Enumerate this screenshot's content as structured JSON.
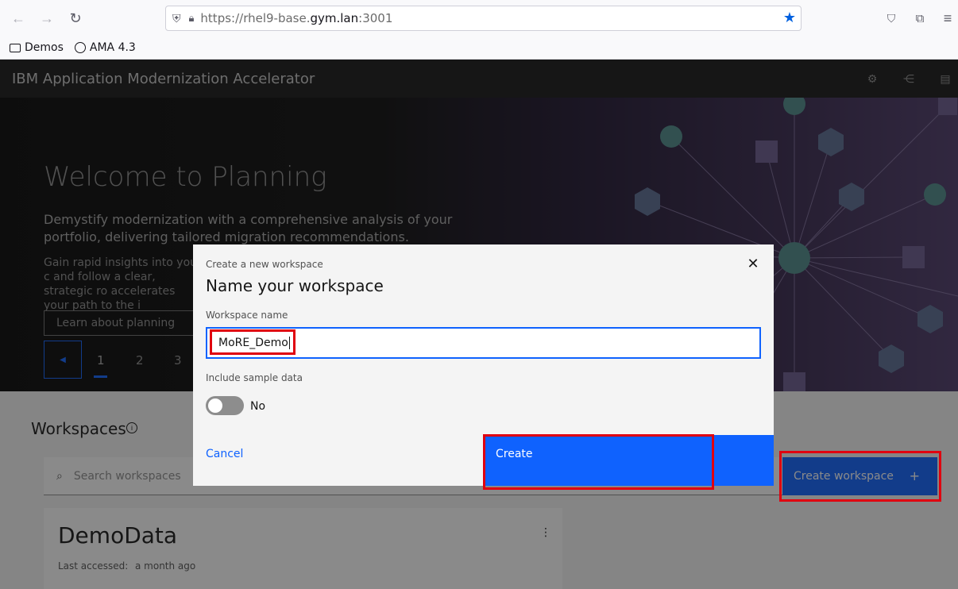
{
  "browser": {
    "url_prefix": "https://rhel9-base.",
    "url_domain": "gym.lan",
    "url_suffix": ":3001",
    "bookmarks": [
      {
        "label": "Demos",
        "icon": "folder-icon"
      },
      {
        "label": "AMA 4.3",
        "icon": "globe-icon"
      }
    ]
  },
  "header": {
    "title": "IBM Application Modernization Accelerator",
    "icons": [
      "settings-icon",
      "topology-icon",
      "document-icon"
    ]
  },
  "hero": {
    "title": "Welcome to Planning",
    "subtitle": "Demystify modernization with a comprehensive analysis of your portfolio, delivering tailored migration recommendations.",
    "body": "Gain rapid insights into your c and follow a clear, strategic ro accelerates your path to the i",
    "learn_button": "Learn about planning",
    "pages": [
      "1",
      "2",
      "3"
    ],
    "active_page": "1"
  },
  "workspaces": {
    "title": "Workspaces",
    "search_placeholder": "Search workspaces",
    "create_button": "Create workspace",
    "cards": [
      {
        "name": "DemoData",
        "meta_label": "Last accessed:",
        "meta_value": "a month ago"
      }
    ]
  },
  "modal": {
    "label": "Create a new workspace",
    "heading": "Name your workspace",
    "field_label": "Workspace name",
    "field_value": "MoRE_Demo",
    "toggle_label": "Include sample data",
    "toggle_state": "No",
    "cancel": "Cancel",
    "create": "Create"
  },
  "colors": {
    "primary": "#0f62fe",
    "header_bg": "#161616",
    "highlight": "#e0000f"
  }
}
